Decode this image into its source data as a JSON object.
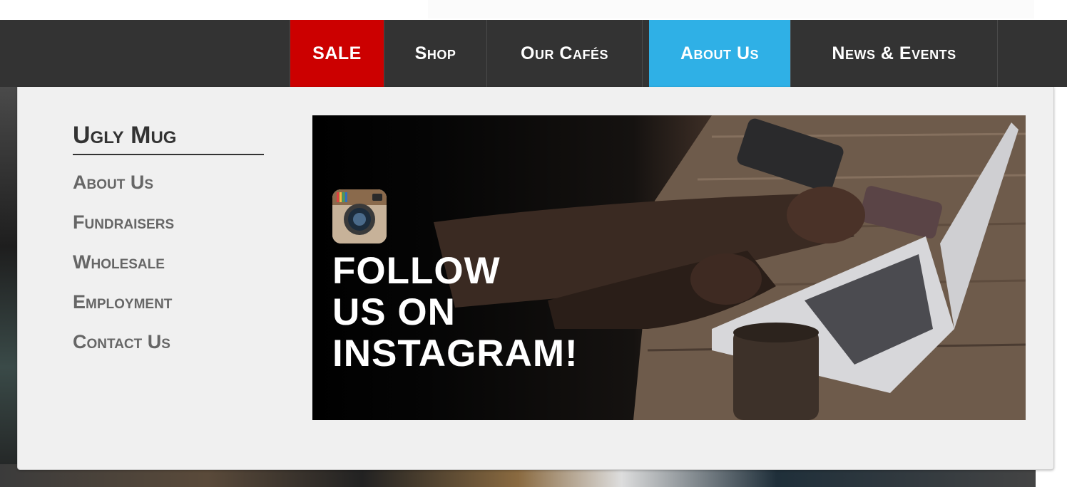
{
  "nav": {
    "items": [
      {
        "label": "SALE",
        "color": "#cc0000"
      },
      {
        "label": "Shop"
      },
      {
        "label": "Our Cafés"
      },
      {
        "label": "About Us",
        "active": true,
        "color": "#2fb0e6"
      },
      {
        "label": "News & Events"
      }
    ],
    "bar_color": "#333333"
  },
  "dropdown": {
    "title": "Ugly Mug",
    "links": [
      "About Us",
      "Fundraisers",
      "Wholesale",
      "Employment",
      "Contact Us"
    ],
    "promo": {
      "line1": "FOLLOW",
      "line2": "US ON",
      "line3": "INSTAGRAM!",
      "icon": "instagram-icon"
    }
  }
}
